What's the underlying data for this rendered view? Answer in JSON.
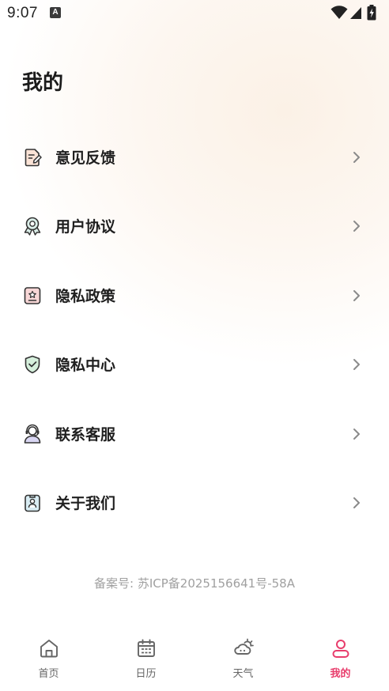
{
  "status_bar": {
    "time": "9:07",
    "notification_icon_letter": "A",
    "icons": [
      "wifi-icon",
      "cellular-signal-icon",
      "battery-charging-icon"
    ]
  },
  "page": {
    "title": "我的"
  },
  "menu": {
    "items": [
      {
        "label": "意见反馈",
        "icon": "feedback-document-icon"
      },
      {
        "label": "用户协议",
        "icon": "award-ribbon-icon"
      },
      {
        "label": "隐私政策",
        "icon": "policy-badge-icon"
      },
      {
        "label": "隐私中心",
        "icon": "shield-check-icon"
      },
      {
        "label": "联系客服",
        "icon": "headset-user-icon"
      },
      {
        "label": "关于我们",
        "icon": "id-badge-icon"
      }
    ]
  },
  "footer": {
    "icp": "备案号: 苏ICP备2025156641号-58A"
  },
  "tab_bar": {
    "tabs": [
      {
        "label": "首页",
        "icon": "home-icon",
        "active": false
      },
      {
        "label": "日历",
        "icon": "calendar-icon",
        "active": false
      },
      {
        "label": "天气",
        "icon": "weather-icon",
        "active": false
      },
      {
        "label": "我的",
        "icon": "profile-icon",
        "active": true
      }
    ],
    "active_color": "#e83d6c",
    "inactive_color": "#666666"
  }
}
